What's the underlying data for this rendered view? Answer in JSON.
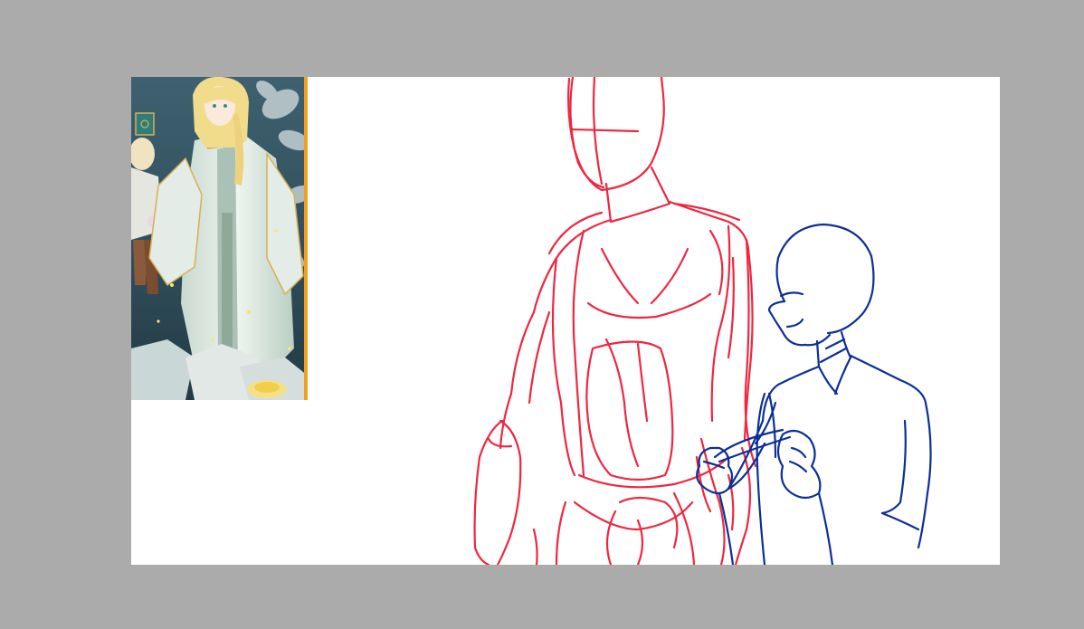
{
  "workspace": {
    "background": "#ababab"
  },
  "canvas": {
    "background": "#ffffff"
  },
  "reference_image": {
    "subject": "anime-character-illustration",
    "palette": {
      "background": "#3b5966",
      "hair": "#f1dc8c",
      "robe": "#dfe9e1",
      "robe_shadow": "#a9c2b5",
      "gold_trim": "#d8b055",
      "border": "#f0a020",
      "flower": "#f5e08a"
    }
  },
  "sketch": {
    "tall_figure": {
      "color": "#f02640"
    },
    "small_figure": {
      "color": "#0b2f96"
    }
  }
}
